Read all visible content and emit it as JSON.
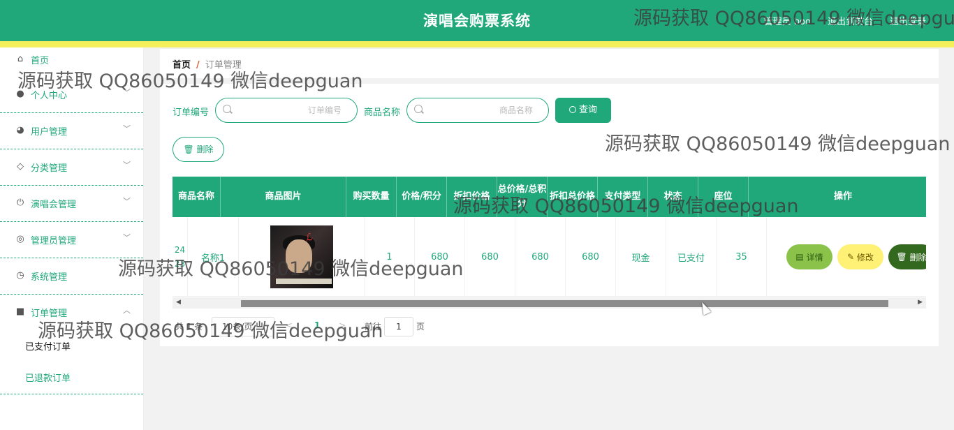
{
  "header": {
    "title": "演唱会购票系统",
    "user_label": "管理员 boo",
    "back_label": "退出到前台",
    "logout_label": "退出登录"
  },
  "sidebar": {
    "items": [
      {
        "label": "首页",
        "icon": "home-icon"
      },
      {
        "label": "个人中心",
        "icon": "user-icon"
      },
      {
        "label": "用户管理",
        "icon": "users-icon"
      },
      {
        "label": "分类管理",
        "icon": "category-icon"
      },
      {
        "label": "演唱会管理",
        "icon": "power-icon"
      },
      {
        "label": "管理员管理",
        "icon": "admin-icon"
      },
      {
        "label": "系统管理",
        "icon": "clock-icon"
      },
      {
        "label": "订单管理",
        "icon": "order-icon"
      }
    ],
    "subitems": [
      {
        "label": "已支付订单"
      },
      {
        "label": "已退款订单"
      }
    ]
  },
  "breadcrumb": {
    "home": "首页",
    "separator": "/",
    "current": "订单管理"
  },
  "search": {
    "order_no_label": "订单编号",
    "order_no_placeholder": "订单编号",
    "product_name_label": "商品名称",
    "product_name_placeholder": "商品名称",
    "query_label": "查询"
  },
  "actions": {
    "delete_label": "删除"
  },
  "table": {
    "columns": [
      "商品名称",
      "商品图片",
      "购买数量",
      "价格/积分",
      "折扣价格",
      "总价格/总积分",
      "折扣总价格",
      "支付类型",
      "状态",
      "座位",
      "操作"
    ],
    "rows": [
      {
        "order_no": "2423",
        "name": "名称1",
        "qty": "1",
        "price": "680",
        "discount_price": "680",
        "total": "680",
        "discount_total": "680",
        "pay_type": "现金",
        "status": "已支付",
        "seat": "35",
        "detail_label": "详情",
        "edit_label": "修改",
        "delete_label": "删除"
      }
    ]
  },
  "pagination": {
    "total_text": "共 1 条",
    "page_size": "10条/页",
    "prev": "<",
    "current_page": "1",
    "next": ">",
    "goto_label": "前往",
    "goto_value": "1",
    "page_label": "页"
  },
  "watermark": "源码获取 QQ86050149 微信deepguan",
  "colors": {
    "primary": "#20a87a",
    "accent_line": "#f4ef5a",
    "detail_button": "#8bc34a",
    "edit_button": "#fff176",
    "delete_button": "#33691e"
  }
}
